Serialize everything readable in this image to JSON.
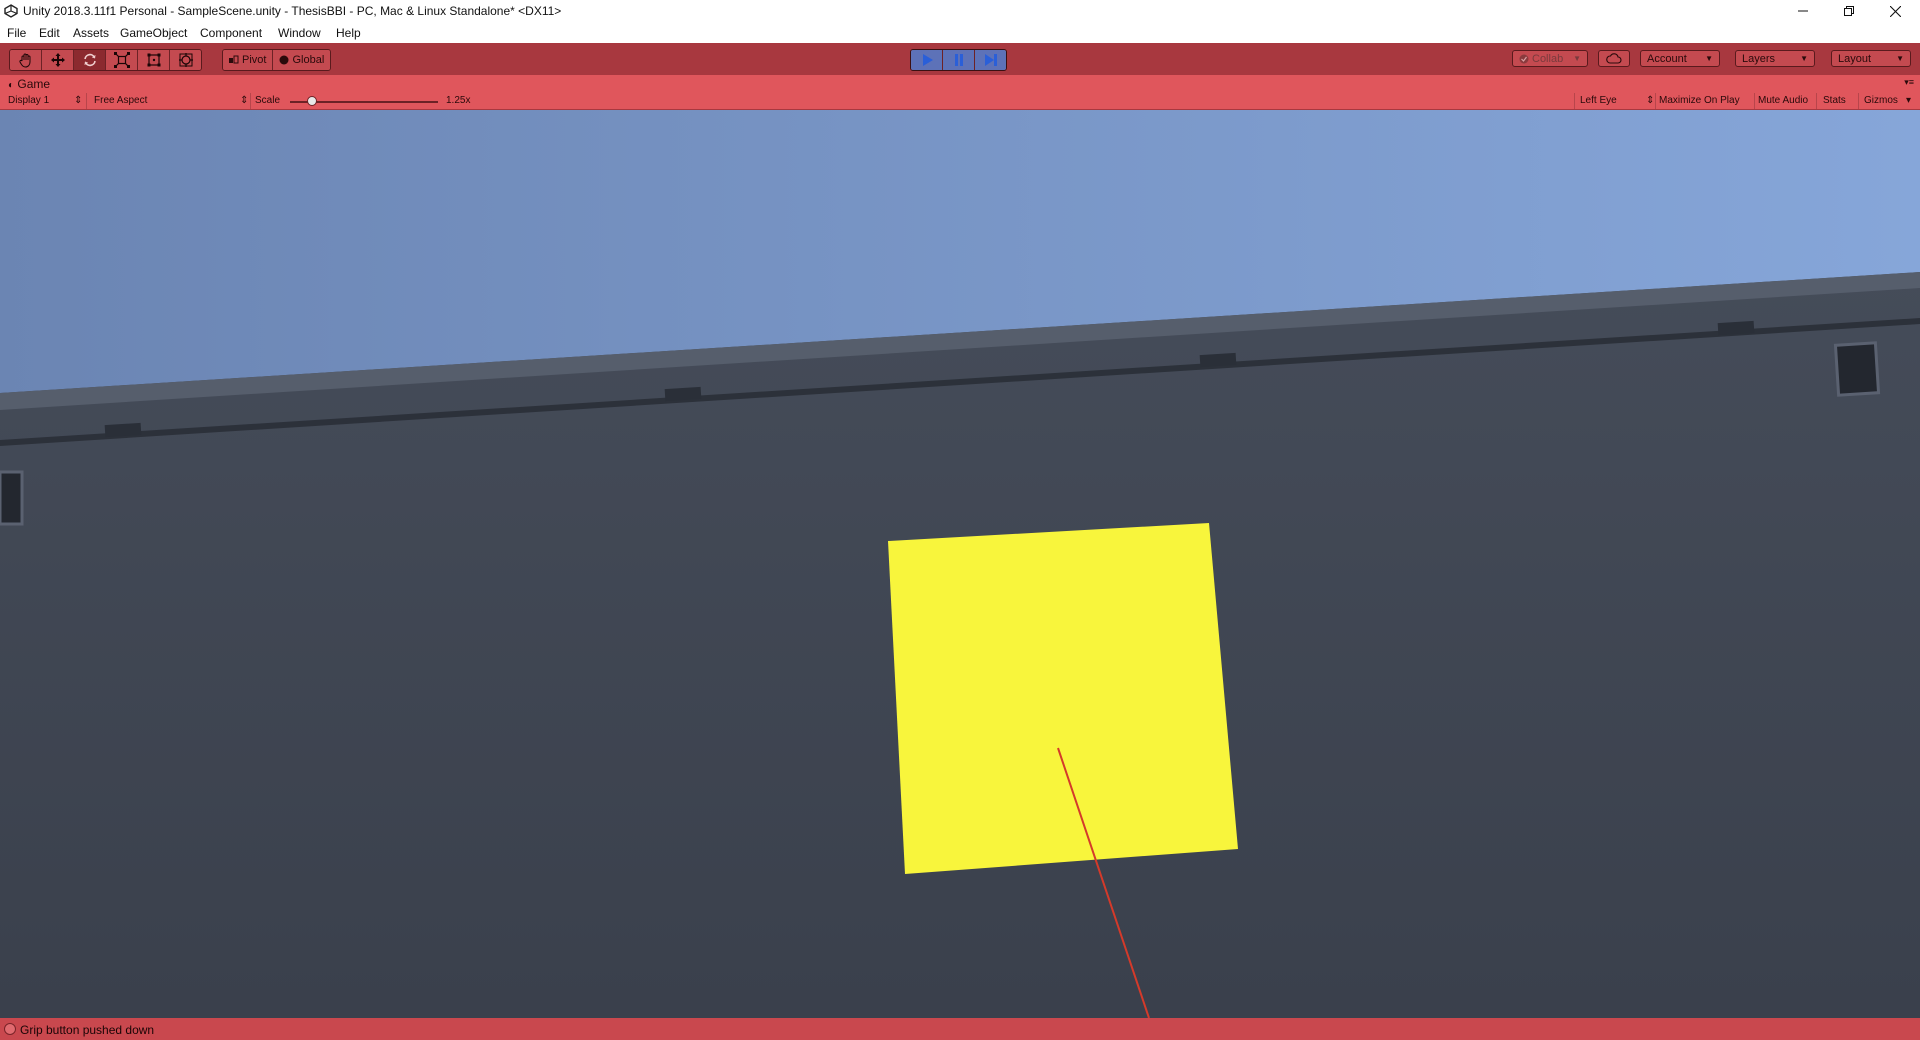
{
  "window": {
    "title": "Unity 2018.3.11f1 Personal - SampleScene.unity - ThesisBBI - PC, Mac & Linux Standalone* <DX11>"
  },
  "menu": [
    "File",
    "Edit",
    "Assets",
    "GameObject",
    "Component",
    "Window",
    "Help"
  ],
  "toolbar": {
    "tools": [
      "hand-tool-icon",
      "move-tool-icon",
      "rotate-tool-icon",
      "scale-tool-icon",
      "rect-tool-icon",
      "transform-tool-icon"
    ],
    "active_tool": "rotate-tool-icon",
    "pivot_label": "Pivot",
    "global_label": "Global",
    "play_state": "playing",
    "collab_label": "Collab",
    "account_label": "Account",
    "layers_label": "Layers",
    "layout_label": "Layout"
  },
  "game_tab": {
    "label": "Game"
  },
  "game_controls": {
    "display": "Display 1",
    "aspect": "Free Aspect",
    "scale_label": "Scale",
    "scale_value": "1.25",
    "eye": "Left Eye",
    "maximize_on_play": "Maximize On Play",
    "mute_audio": "Mute Audio",
    "stats": "Stats",
    "gizmos": "Gizmos"
  },
  "status": {
    "message": "Grip button pushed down"
  },
  "colors": {
    "play_tint": "#a8383f",
    "sky": "#7a94c2",
    "wall": "#3d4350",
    "yellow_panel": "#f8f53c",
    "laser": "#d43a2a"
  }
}
